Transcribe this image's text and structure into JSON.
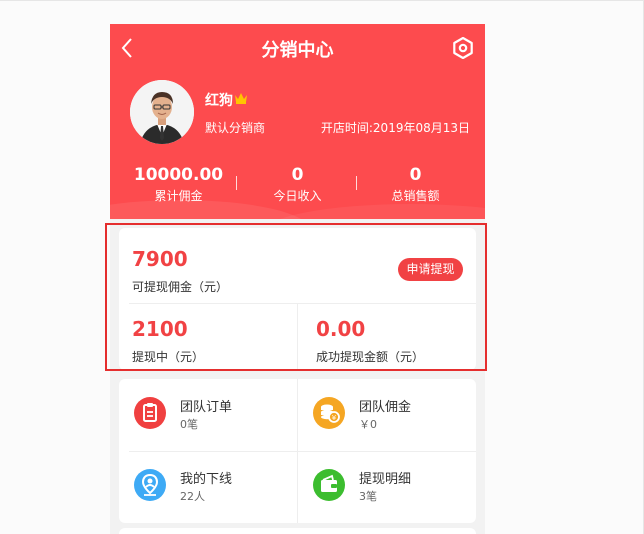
{
  "header": {
    "title": "分销中心",
    "user_name": "红狗",
    "role": "默认分销商",
    "open_date": "开店时间:2019年08月13日"
  },
  "stats": [
    {
      "value": "10000.00",
      "label": "累计佣金"
    },
    {
      "value": "0",
      "label": "今日收入"
    },
    {
      "value": "0",
      "label": "总销售额"
    }
  ],
  "withdraw": {
    "available_value": "7900",
    "available_label": "可提现佣金（元）",
    "button_label": "申请提现",
    "pending_value": "2100",
    "pending_label": "提现中（元）",
    "success_value": "0.00",
    "success_label": "成功提现金额（元）"
  },
  "menu": [
    {
      "label": "团队订单",
      "sub": "0笔",
      "icon": "order-icon"
    },
    {
      "label": "团队佣金",
      "sub": "￥0",
      "icon": "coins-icon"
    },
    {
      "label": "我的下线",
      "sub": "22人",
      "icon": "user-location-icon"
    },
    {
      "label": "提现明细",
      "sub": "3笔",
      "icon": "wallet-icon"
    }
  ],
  "colors": {
    "brand": "#fd4b4e",
    "accent_text": "#f14244",
    "highlight_border": "#e52e2e",
    "order_icon": "#f04040",
    "coins_icon": "#f5a623",
    "user_icon": "#3eaaf5",
    "wallet_icon": "#3cbd2f"
  }
}
